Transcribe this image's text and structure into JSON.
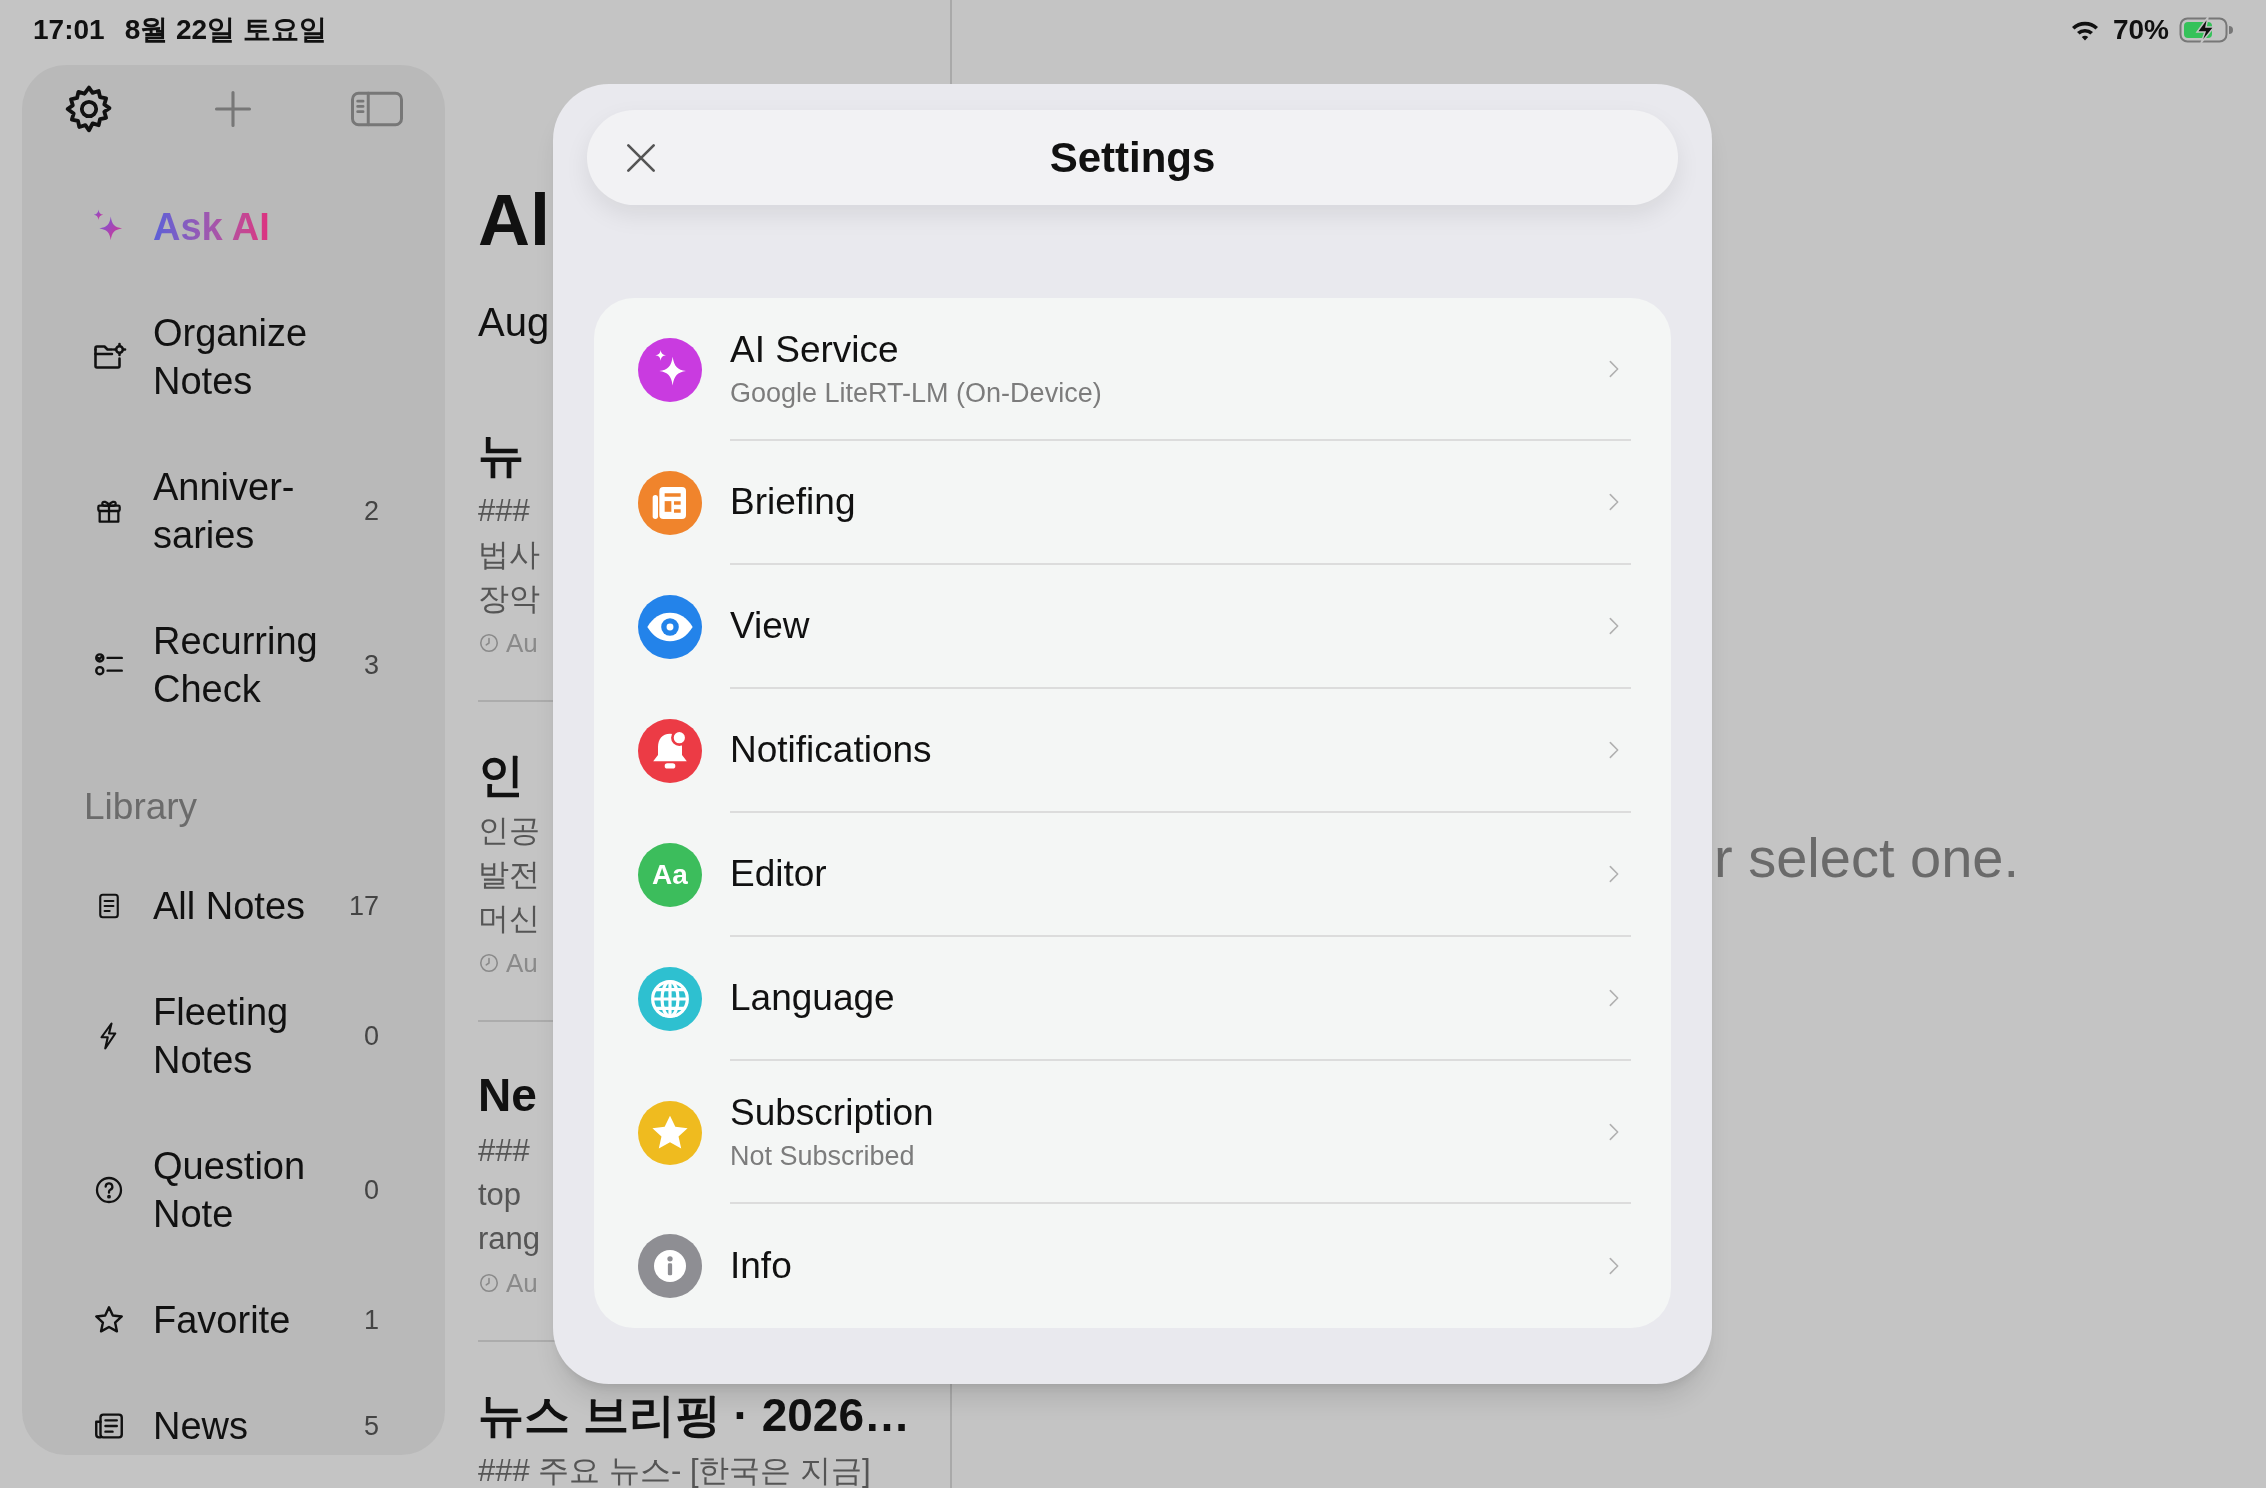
{
  "status_bar": {
    "time": "17:01",
    "date": "8월 22일 토요일",
    "battery": "70%"
  },
  "sidebar": {
    "items": [
      {
        "kind": "ai",
        "lines": [
          "Ask AI"
        ]
      },
      {
        "kind": "folder",
        "lines": [
          "Organize",
          "Notes"
        ]
      },
      {
        "kind": "gift",
        "lines": [
          "Anniver-",
          "saries"
        ],
        "count": "2"
      },
      {
        "kind": "checklist",
        "lines": [
          "Recurring",
          "Check"
        ],
        "count": "3"
      }
    ],
    "library": {
      "title": "Library",
      "items": [
        {
          "kind": "document",
          "lines": [
            "All Notes"
          ],
          "count": "17"
        },
        {
          "kind": "bolt",
          "lines": [
            "Fleeting",
            "Notes"
          ],
          "count": "0"
        },
        {
          "kind": "question",
          "lines": [
            "Question",
            "Note"
          ],
          "count": "0"
        },
        {
          "kind": "star",
          "lines": [
            "Favorite"
          ],
          "count": "1"
        },
        {
          "kind": "news",
          "lines": [
            "News"
          ],
          "count": "5"
        }
      ]
    }
  },
  "note_list": {
    "title": "Al",
    "date_header": "Aug",
    "notes": [
      {
        "title": "뉴",
        "lines": [
          "###",
          "법사",
          "장악"
        ],
        "meta": "Au"
      },
      {
        "title": "인",
        "lines": [
          "인공",
          "발전",
          "머신"
        ],
        "meta": "Au"
      },
      {
        "title": "Ne",
        "lines": [
          "###",
          "top",
          "rang"
        ],
        "meta": "Au"
      },
      {
        "title": "뉴스 브리핑 · 2026…",
        "lines": [
          "### 주요 뉴스- [한국은 지금]"
        ]
      }
    ]
  },
  "detail": {
    "hint": "r select one."
  },
  "settings": {
    "title": "Settings",
    "rows": [
      {
        "kind": "sparkle",
        "color": "#c93be0",
        "label": "AI Service",
        "sublabel": "Google LiteRT-LM (On-Device)"
      },
      {
        "kind": "newspaper",
        "color": "#f0842c",
        "label": "Briefing"
      },
      {
        "kind": "eye",
        "color": "#2383ea",
        "label": "View"
      },
      {
        "kind": "bell",
        "color": "#ec3b45",
        "label": "Notifications"
      },
      {
        "kind": "text",
        "color": "#3cbd5c",
        "label": "Editor",
        "icon_text": "Aa"
      },
      {
        "kind": "globe",
        "color": "#2ec0d0",
        "label": "Language"
      },
      {
        "kind": "star",
        "color": "#efbb1f",
        "label": "Subscription",
        "sublabel": "Not Subscribed"
      },
      {
        "kind": "info",
        "color": "#8e8e93",
        "label": "Info"
      }
    ]
  }
}
